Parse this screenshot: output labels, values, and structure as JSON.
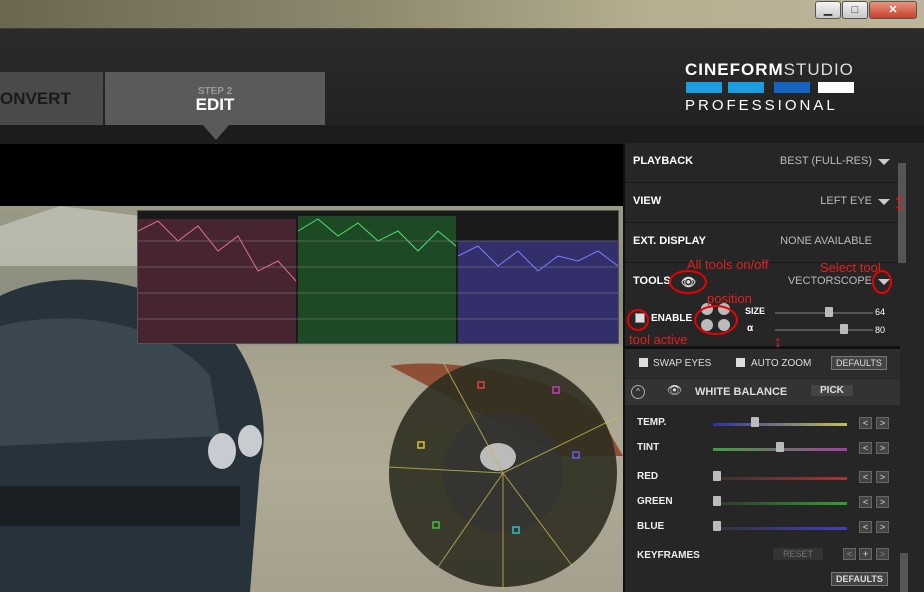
{
  "header": {
    "tab_convert": "ONVERT",
    "tab_edit_step": "STEP 2",
    "tab_edit_label": "EDIT",
    "logo_brand": "CINEFORM",
    "logo_studio": "STUDIO",
    "logo_edition": "PROFESSIONAL",
    "logo_colors": [
      "#1a9ee0",
      "#1a9ee0",
      "#1565c0",
      "#ffffff"
    ]
  },
  "window_buttons": {
    "minimize": "▁",
    "maximize": "□",
    "close": "✕"
  },
  "settings": {
    "playback": {
      "label": "PLAYBACK",
      "value": "BEST (FULL-RES)"
    },
    "view": {
      "label": "VIEW",
      "value": "LEFT EYE"
    },
    "ext_display": {
      "label": "EXT. DISPLAY",
      "value": "NONE AVAILABLE"
    },
    "tools": {
      "label": "TOOLS",
      "value": "VECTORSCOPE"
    },
    "enable_label": "ENABLE",
    "size_label": "SIZE",
    "size_value": "64",
    "alpha_label": "α",
    "alpha_value": "80"
  },
  "options": {
    "swap_eyes": "SWAP EYES",
    "auto_zoom": "AUTO ZOOM",
    "defaults": "DEFAULTS"
  },
  "white_balance": {
    "title": "WHITE BALANCE",
    "pick": "PICK",
    "rows": [
      {
        "label": "TEMP.",
        "level": 0.3
      },
      {
        "label": "TINT",
        "level": 0.5
      },
      {
        "label": "RED",
        "level": 0.0
      },
      {
        "label": "GREEN",
        "level": 0.0
      },
      {
        "label": "BLUE",
        "level": 0.0
      }
    ],
    "keyframes": "KEYFRAMES",
    "reset": "RESET",
    "defaults": "DEFAULTS"
  },
  "annotations": {
    "all_tools": "All tools on/off",
    "select_tool": "Select tool",
    "position": "position",
    "tool_active": "tool active"
  },
  "stepper": {
    "prev": "<",
    "next": ">",
    "add": "+"
  }
}
